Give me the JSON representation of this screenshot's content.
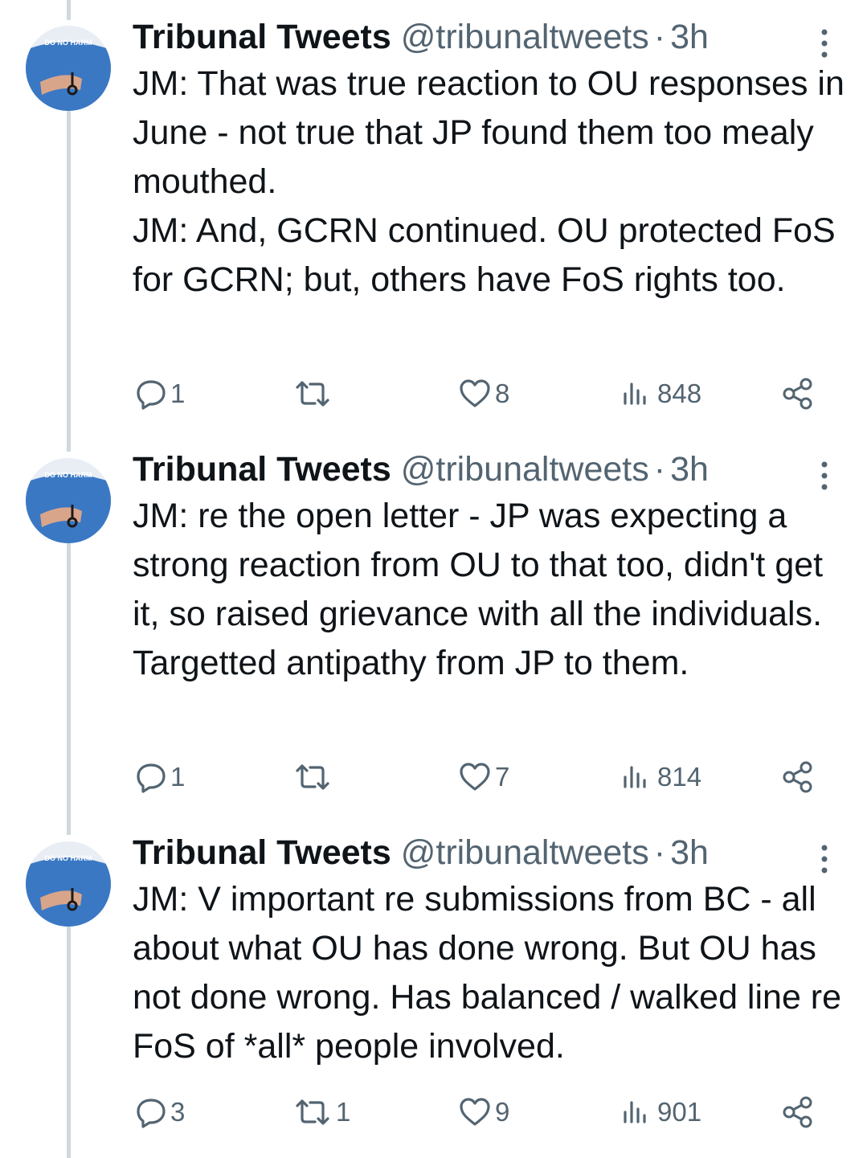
{
  "tweets": [
    {
      "avatar_badge": "DO NO HARM",
      "display_name": "Tribunal Tweets",
      "handle": "@tribunaltweets",
      "separator": "·",
      "time": "3h",
      "text": "JM: That was true reaction to OU responses in June - not true that JP found them too mealy mouthed.\nJM: And, GCRN continued. OU protected FoS for GCRN; but, others have FoS rights too.",
      "replies": "1",
      "retweets": "",
      "likes": "8",
      "views": "848"
    },
    {
      "avatar_badge": "DO NO HARM",
      "display_name": "Tribunal Tweets",
      "handle": "@tribunaltweets",
      "separator": "·",
      "time": "3h",
      "text": "JM: re the open letter - JP was expecting a strong reaction from OU to that too, didn't get it, so raised grievance with all the individuals. Targetted antipathy from JP to them.",
      "replies": "1",
      "retweets": "",
      "likes": "7",
      "views": "814"
    },
    {
      "avatar_badge": "DO NO HARM",
      "display_name": "Tribunal Tweets",
      "handle": "@tribunaltweets",
      "separator": "·",
      "time": "3h",
      "text": "JM: V important re submissions from BC - all about what OU has done wrong. But OU has not done wrong. Has balanced / walked line re FoS of *all* people involved.",
      "replies": "3",
      "retweets": "1",
      "likes": "9",
      "views": "901"
    }
  ],
  "colors": {
    "text": "#0f1419",
    "secondary": "#536471",
    "thread_line": "#cfd9de",
    "avatar_shirt": "#3b78c4"
  },
  "icons": [
    "more-options-icon",
    "reply-icon",
    "retweet-icon",
    "like-icon",
    "views-icon",
    "share-icon"
  ]
}
